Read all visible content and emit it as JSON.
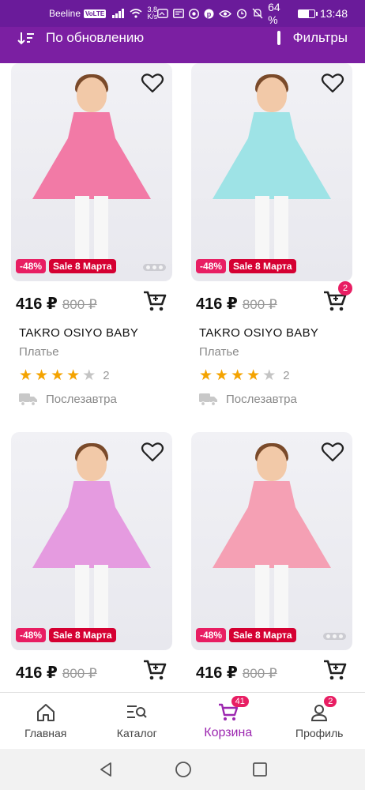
{
  "status_bar": {
    "carrier": "Beeline",
    "volte": "VoLTE",
    "speed_value": "3,8",
    "speed_unit": "K/s",
    "battery": "64 %",
    "battery_level": 0.64,
    "time": "13:48"
  },
  "toolbar": {
    "sort_label": "По обновлению",
    "filters_label": "Фильтры"
  },
  "products": [
    {
      "discount": "-48%",
      "sale_badge": "Sale 8 Марта",
      "price": "416 ₽",
      "old_price": "800 ₽",
      "brand": "TAKRO OSIYO BABY",
      "type": "Платье",
      "rating": 4,
      "reviews": "2",
      "delivery": "Послезавтра",
      "cart_count": "",
      "dress_color": "#f27aa6",
      "image_dots": 3
    },
    {
      "discount": "-48%",
      "sale_badge": "Sale 8 Марта",
      "price": "416 ₽",
      "old_price": "800 ₽",
      "brand": "TAKRO OSIYO BABY",
      "type": "Платье",
      "rating": 4,
      "reviews": "2",
      "delivery": "Послезавтра",
      "cart_count": "2",
      "dress_color": "#9ee3e6",
      "image_dots": 0
    },
    {
      "discount": "-48%",
      "sale_badge": "Sale 8 Марта",
      "price": "416 ₽",
      "old_price": "800 ₽",
      "brand": "",
      "type": "",
      "rating": 0,
      "reviews": "",
      "delivery": "",
      "cart_count": "",
      "dress_color": "#e59be0",
      "image_dots": 0
    },
    {
      "discount": "-48%",
      "sale_badge": "Sale 8 Марта",
      "price": "416 ₽",
      "old_price": "800 ₽",
      "brand": "",
      "type": "",
      "rating": 0,
      "reviews": "",
      "delivery": "",
      "cart_count": "",
      "dress_color": "#f5a0b4",
      "image_dots": 3
    }
  ],
  "bottom_nav": [
    {
      "label": "Главная",
      "icon": "home-icon",
      "badge": "",
      "active": false
    },
    {
      "label": "Каталог",
      "icon": "catalog-search-icon",
      "badge": "",
      "active": false
    },
    {
      "label": "Корзина",
      "icon": "cart-icon",
      "badge": "41",
      "active": true
    },
    {
      "label": "Профиль",
      "icon": "profile-icon",
      "badge": "2",
      "active": false
    }
  ],
  "colors": {
    "header": "#7b1fa2",
    "accent": "#9c27b0",
    "discount_badge": "#e81e63",
    "sale_badge": "#d50032",
    "star": "#f4a300"
  }
}
